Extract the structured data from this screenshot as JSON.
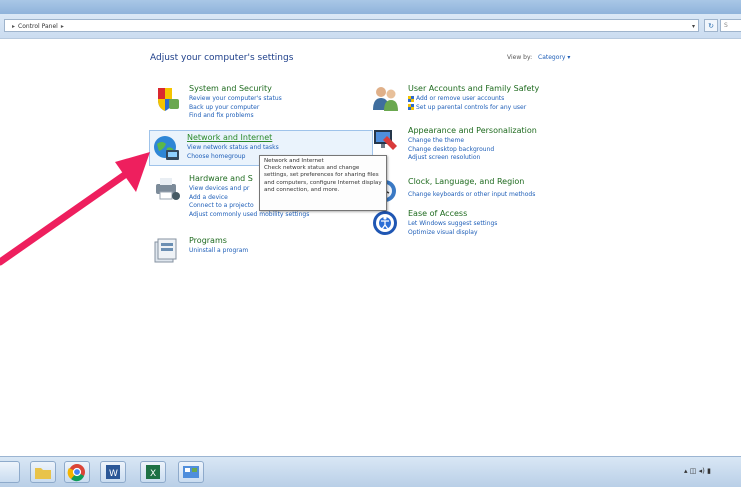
{
  "address_bar": {
    "breadcrumb": "Control Panel",
    "search_placeholder": "S"
  },
  "main": {
    "heading": "Adjust your computer's settings",
    "view_by_label": "View by:",
    "view_by_value": "Category"
  },
  "categories": {
    "system_security": {
      "title": "System and Security",
      "links": [
        "Review your computer's status",
        "Back up your computer",
        "Find and fix problems"
      ]
    },
    "network_internet": {
      "title": "Network and Internet",
      "links": [
        "View network status and tasks",
        "Choose homegroup"
      ]
    },
    "hardware_sound": {
      "title": "Hardware and S",
      "links": [
        "View devices and pr",
        "Add a device",
        "Connect to a projecto",
        "Adjust commonly used mobility settings"
      ]
    },
    "programs": {
      "title": "Programs",
      "links": [
        "Uninstall a program"
      ]
    },
    "user_accounts": {
      "title": "User Accounts and Family Safety",
      "links": [
        "Add or remove user accounts",
        "Set up parental controls for any user"
      ]
    },
    "appearance": {
      "title": "Appearance and Personalization",
      "links": [
        "Change the theme",
        "Change desktop background",
        "Adjust screen resolution"
      ]
    },
    "clock_language": {
      "title": "Clock, Language, and Region",
      "links": [
        "Change keyboards or other input methods"
      ]
    },
    "ease_access": {
      "title": "Ease of Access",
      "links": [
        "Let Windows suggest settings",
        "Optimize visual display"
      ]
    }
  },
  "tooltip": {
    "title": "Network and Internet",
    "body": "Check network status and change settings, set preferences for sharing files and computers, configure Internet display and connection, and more."
  },
  "taskbar": {
    "apps": [
      "explorer",
      "chrome",
      "word",
      "excel",
      "control-panel"
    ]
  },
  "colors": {
    "link": "#1f5fb8",
    "category_title": "#1e6a1e",
    "heading": "#1e3f8a",
    "annotation_arrow": "#ee1f5e"
  }
}
